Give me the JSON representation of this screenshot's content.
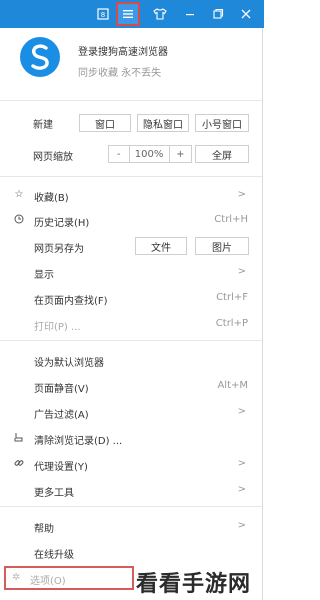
{
  "titlebar": {
    "icons": [
      "skin-icon",
      "menu-icon",
      "shirt-icon",
      "minimize-icon",
      "restore-icon",
      "close-icon"
    ]
  },
  "account": {
    "title": "登录搜狗高速浏览器",
    "subtitle": "同步收藏 永不丢失"
  },
  "new_row": {
    "label": "新建",
    "window": "窗口",
    "private": "隐私窗口",
    "small": "小号窗口"
  },
  "zoom_row": {
    "label": "网页缩放",
    "minus": "-",
    "level": "100%",
    "plus": "+",
    "fullscreen": "全屏"
  },
  "group1": [
    {
      "label": "收藏(B)",
      "shortcut": "",
      "arrow": true,
      "icon": "star-icon"
    },
    {
      "label": "历史记录(H)",
      "shortcut": "Ctrl+H",
      "arrow": false,
      "icon": "clock-icon"
    }
  ],
  "save_row": {
    "label": "网页另存为",
    "file": "文件",
    "image": "图片"
  },
  "group2": [
    {
      "label": "显示",
      "shortcut": "",
      "arrow": true
    },
    {
      "label": "在页面内查找(F)",
      "shortcut": "Ctrl+F",
      "arrow": false
    },
    {
      "label": "打印(P) ...",
      "shortcut": "Ctrl+P",
      "arrow": false
    }
  ],
  "group3": [
    {
      "label": "设为默认浏览器",
      "shortcut": "",
      "arrow": false
    },
    {
      "label": "页面静音(V)",
      "shortcut": "Alt+M",
      "arrow": false
    },
    {
      "label": "广告过滤(A)",
      "shortcut": "",
      "arrow": true
    },
    {
      "label": "清除浏览记录(D) ...",
      "shortcut": "",
      "arrow": false
    },
    {
      "label": "代理设置(Y)",
      "shortcut": "",
      "arrow": true
    },
    {
      "label": "更多工具",
      "shortcut": "",
      "arrow": true
    }
  ],
  "group4": [
    {
      "label": "帮助",
      "shortcut": "",
      "arrow": true
    },
    {
      "label": "在线升级",
      "shortcut": "",
      "arrow": false
    }
  ],
  "options": {
    "label": "选项(O)"
  },
  "watermark": "看看手游网",
  "colors": {
    "titlebar": "#1f88d9",
    "highlight": "#d94a4a"
  }
}
